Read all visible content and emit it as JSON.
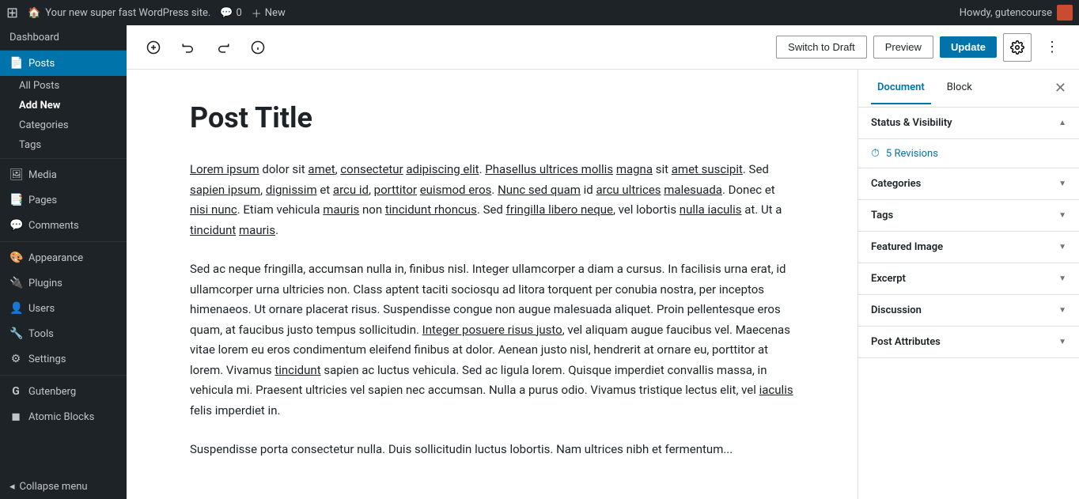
{
  "admin_bar": {
    "logo": "W",
    "site_name": "Your new super fast WordPress site.",
    "comments_count": "0",
    "new_label": "New",
    "howdy": "Howdy, gutencourse"
  },
  "sidebar": {
    "dashboard_label": "Dashboard",
    "items": [
      {
        "id": "posts",
        "label": "Posts",
        "icon": "📄",
        "active": true
      },
      {
        "id": "all-posts",
        "label": "All Posts",
        "sub": true
      },
      {
        "id": "add-new",
        "label": "Add New",
        "sub": true,
        "bold": true
      },
      {
        "id": "categories",
        "label": "Categories",
        "sub": true
      },
      {
        "id": "tags",
        "label": "Tags",
        "sub": true
      },
      {
        "id": "media",
        "label": "Media",
        "icon": "🖼"
      },
      {
        "id": "pages",
        "label": "Pages",
        "icon": "📑"
      },
      {
        "id": "comments",
        "label": "Comments",
        "icon": "💬"
      },
      {
        "id": "appearance",
        "label": "Appearance",
        "icon": "🎨"
      },
      {
        "id": "plugins",
        "label": "Plugins",
        "icon": "🔌"
      },
      {
        "id": "users",
        "label": "Users",
        "icon": "👤"
      },
      {
        "id": "tools",
        "label": "Tools",
        "icon": "🔧"
      },
      {
        "id": "settings",
        "label": "Settings",
        "icon": "⚙"
      },
      {
        "id": "gutenberg",
        "label": "Gutenberg",
        "icon": "G"
      },
      {
        "id": "atomic-blocks",
        "label": "Atomic Blocks",
        "icon": "◼"
      }
    ],
    "collapse_label": "Collapse menu"
  },
  "toolbar": {
    "switch_draft_label": "Switch to Draft",
    "preview_label": "Preview",
    "update_label": "Update"
  },
  "editor": {
    "post_title": "Post Title",
    "paragraphs": [
      "Lorem ipsum dolor sit amet, consectetur adipiscing elit. Phasellus ultrices mollis magna sit amet suscipit. Sed sapien ipsum, dignissim et arcu id, porttitor euismod eros. Nunc sed quam id arcu ultrices malesuada. Donec et nisi nunc. Etiam vehicula mauris non tincidunt rhoncus. Sed fringilla libero neque, vel lobortis nulla iaculis at. Ut a tincidunt mauris.",
      "Sed ac neque fringilla, accumsan nulla in, finibus nisl. Integer ullamcorper a diam a cursus. In facilisis urna erat, id ullamcorper urna ultricies non. Class aptent taciti sociosqu ad litora torquent per conubia nostra, per inceptos himenaeos. Ut ornare placerat risus. Suspendisse congue non augue malesuada aliquet. Proin pellentesque eros quam, at faucibus justo tempus sollicitudin. Integer posuere risus justo, vel aliquam augue faucibus vel. Maecenas vitae lorem eu eros condimentum eleifend finibus at dolor. Aenean justo nisl, hendrerit at ornare eu, porttitor at lorem. Vivamus tincidunt sapien ac luctus vehicula. Sed ac ligula lorem. Quisque imperdiet convallis massa, in vehicula mi. Praesent ultricies vel sapien nec accumsan. Nulla a purus odio. Vivamus tristique lectus elit, vel iaculis felis imperdiet in.",
      "Suspendisse porta consectetur nulla. Duis sollicitudin luctus lobortis. Nam ultrices nibh et fermentum..."
    ]
  },
  "right_panel": {
    "tabs": [
      {
        "id": "document",
        "label": "Document",
        "active": true
      },
      {
        "id": "block",
        "label": "Block",
        "active": false
      }
    ],
    "sections": [
      {
        "id": "status-visibility",
        "label": "Status & Visibility",
        "expanded": true
      },
      {
        "id": "revisions",
        "label": "5 Revisions",
        "is_revisions": true
      },
      {
        "id": "categories",
        "label": "Categories",
        "expanded": false
      },
      {
        "id": "tags",
        "label": "Tags",
        "expanded": false
      },
      {
        "id": "featured-image",
        "label": "Featured Image",
        "expanded": false
      },
      {
        "id": "excerpt",
        "label": "Excerpt",
        "expanded": false
      },
      {
        "id": "discussion",
        "label": "Discussion",
        "expanded": false
      },
      {
        "id": "post-attributes",
        "label": "Post Attributes",
        "expanded": false
      }
    ]
  }
}
